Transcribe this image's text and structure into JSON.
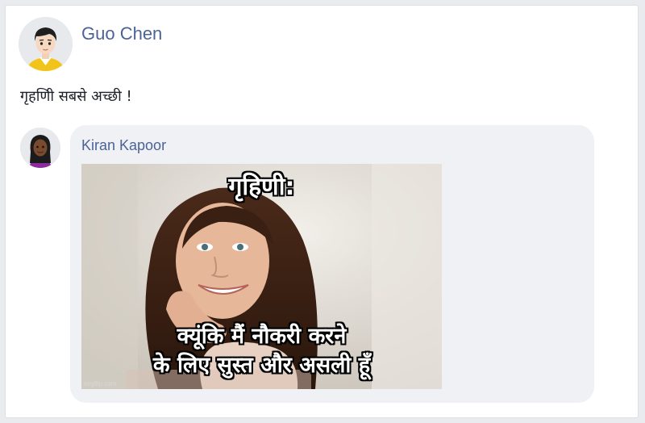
{
  "post": {
    "author": "Guo Chen",
    "text": "गृहणिी सबसे अच्छी !"
  },
  "reply": {
    "author": "Kiran Kapoor",
    "meme": {
      "top_text": "गृहिणी:",
      "bottom_line1": "क्यूंकि मैं नौकरी करने",
      "bottom_line2": "के लिए सुस्त और असली हूँ",
      "watermark": "imgflip.com"
    }
  },
  "colors": {
    "author_link": "#4b6396",
    "bubble_bg": "#eff1f4",
    "page_bg": "#e9ebee"
  }
}
